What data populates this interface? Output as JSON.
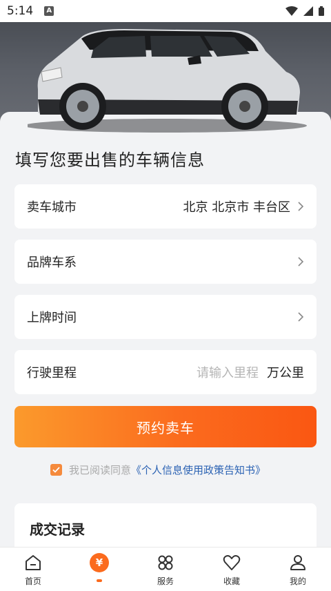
{
  "status_bar": {
    "time": "5:14"
  },
  "form": {
    "title": "填写您要出售的车辆信息",
    "city": {
      "label": "卖车城市",
      "value": "北京 北京市 丰台区"
    },
    "brand": {
      "label": "品牌车系"
    },
    "plate_time": {
      "label": "上牌时间"
    },
    "mileage": {
      "label": "行驶里程",
      "placeholder": "请输入里程",
      "unit": "万公里"
    },
    "submit_label": "预约卖车"
  },
  "agreement": {
    "checked": true,
    "prefix": "我已阅读同意",
    "link": "《个人信息使用政策告知书》"
  },
  "records": {
    "title": "成交记录"
  },
  "tabbar": {
    "items": [
      {
        "label": "首页",
        "icon": "home-icon"
      },
      {
        "label": "",
        "icon": "yuan-icon",
        "active": true
      },
      {
        "label": "服务",
        "icon": "grid-icon"
      },
      {
        "label": "收藏",
        "icon": "heart-icon"
      },
      {
        "label": "我的",
        "icon": "user-icon"
      }
    ]
  },
  "colors": {
    "accent": "#fb6b1e",
    "link": "#2b62b3"
  }
}
